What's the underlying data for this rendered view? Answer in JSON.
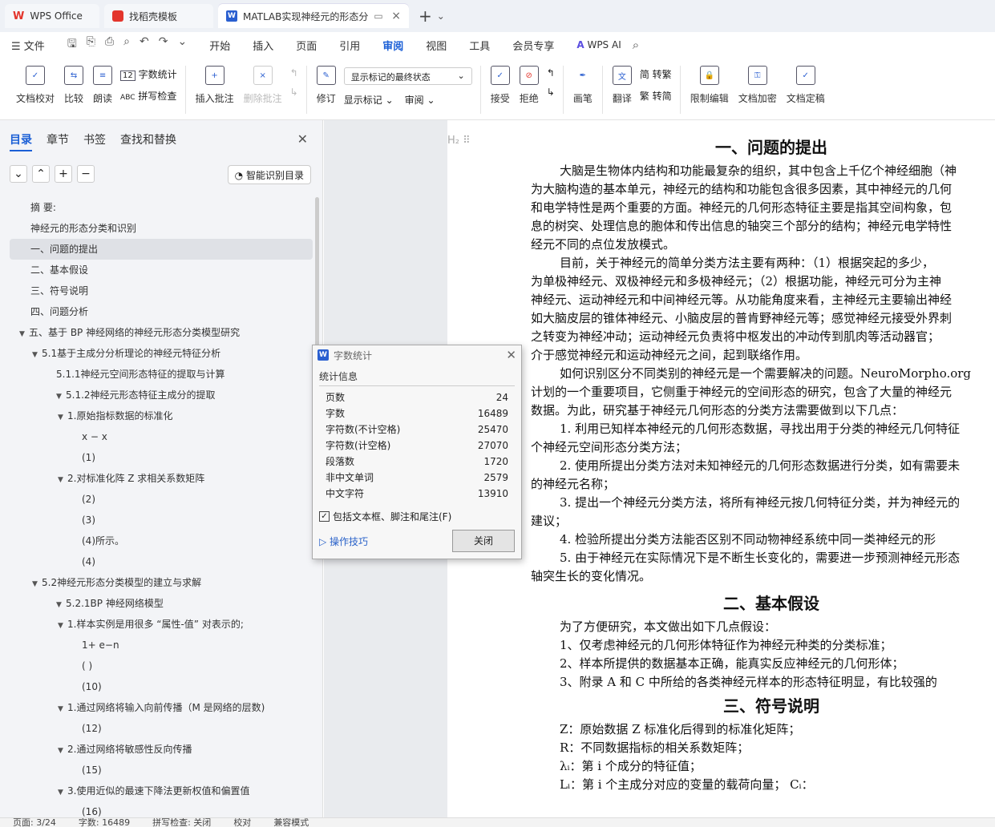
{
  "tabs": [
    {
      "label": "WPS Office",
      "icon": "wps-logo"
    },
    {
      "label": "找稻壳模板",
      "icon": "docer-logo"
    },
    {
      "label": "MATLAB实现神经元的形态分",
      "icon": "wps-writer-logo"
    }
  ],
  "menu": {
    "file": "文件",
    "items": [
      "开始",
      "插入",
      "页面",
      "引用",
      "审阅",
      "视图",
      "工具",
      "会员专享"
    ],
    "active": "审阅",
    "ai": "WPS AI"
  },
  "ribbon": {
    "doc_check": "文档校对",
    "compare": "比较",
    "read_aloud": "朗读",
    "word_count": "字数统计",
    "spell_check": "拼写检查",
    "insert_comment": "插入批注",
    "delete_comment": "删除批注",
    "revise": "修订",
    "markup_state": "显示标记的最终状态",
    "show_markup": "显示标记",
    "review": "审阅",
    "accept": "接受",
    "reject": "拒绝",
    "pen": "画笔",
    "translate": "翻译",
    "to_traditional": "简 转繁",
    "to_simplified": "繁 转简",
    "restrict_edit": "限制编辑",
    "encrypt": "文档加密",
    "finalize": "文档定稿"
  },
  "sidebar": {
    "tabs": [
      "目录",
      "章节",
      "书签",
      "查找和替换"
    ],
    "smart_btn": "智能识别目录",
    "toc": [
      {
        "label": "摘 要:",
        "level": 1,
        "arrow": ""
      },
      {
        "label": "神经元的形态分类和识别",
        "level": 1,
        "arrow": ""
      },
      {
        "label": "一、问题的提出",
        "level": 1,
        "arrow": "",
        "selected": true
      },
      {
        "label": "二、基本假设",
        "level": 1,
        "arrow": ""
      },
      {
        "label": "三、符号说明",
        "level": 1,
        "arrow": ""
      },
      {
        "label": "四、问题分析",
        "level": 1,
        "arrow": ""
      },
      {
        "label": "五、基于 BP 神经网络的神经元形态分类模型研究",
        "level": 0,
        "arrow": "▼"
      },
      {
        "label": "5.1基于主成分分析理论的神经元特征分析",
        "level": 2,
        "arrow": "▼"
      },
      {
        "label": "5.1.1神经元空间形态特征的提取与计算",
        "level": 3,
        "arrow": ""
      },
      {
        "label": "5.1.2神经元形态特征主成分的提取",
        "level": 3,
        "arrow": "▼"
      },
      {
        "label": "1.原始指标数据的标准化",
        "level": 4,
        "arrow": "▼"
      },
      {
        "label": "x − x",
        "level": 5,
        "arrow": ""
      },
      {
        "label": "(1)",
        "level": 5,
        "arrow": ""
      },
      {
        "label": "2.对标准化阵 Z 求相关系数矩阵",
        "level": 4,
        "arrow": "▼"
      },
      {
        "label": "(2)",
        "level": 5,
        "arrow": ""
      },
      {
        "label": "(3)",
        "level": 5,
        "arrow": ""
      },
      {
        "label": "(4)所示。",
        "level": 5,
        "arrow": ""
      },
      {
        "label": "(4)",
        "level": 5,
        "arrow": ""
      },
      {
        "label": "5.2神经元形态分类模型的建立与求解",
        "level": 2,
        "arrow": "▼"
      },
      {
        "label": "5.2.1BP 神经网络模型",
        "level": 3,
        "arrow": "▼"
      },
      {
        "label": "1.样本实例是用很多 “属性-值” 对表示的;",
        "level": 4,
        "arrow": "▼"
      },
      {
        "label": "1+ e−n",
        "level": 5,
        "arrow": ""
      },
      {
        "label": "( )",
        "level": 5,
        "arrow": ""
      },
      {
        "label": "(10)",
        "level": 5,
        "arrow": ""
      },
      {
        "label": "1.通过网络将输入向前传播（M 是网络的层数)",
        "level": 4,
        "arrow": "▼"
      },
      {
        "label": "(12)",
        "level": 5,
        "arrow": ""
      },
      {
        "label": "2.通过网络将敏感性反向传播",
        "level": 4,
        "arrow": "▼"
      },
      {
        "label": "(15)",
        "level": 5,
        "arrow": ""
      },
      {
        "label": "3.使用近似的最速下降法更新权值和偏置值",
        "level": 4,
        "arrow": "▼"
      },
      {
        "label": "(16)",
        "level": 5,
        "arrow": ""
      }
    ]
  },
  "document": {
    "heading_marker": "H₂",
    "section1_title": "一、问题的提出",
    "section1_paras": [
      {
        "text": "大脑是生物体内结构和功能最复杂的组织，其中包含上千亿个神经细胞（神",
        "indent": true
      },
      {
        "text": "为大脑构造的基本单元，神经元的结构和功能包含很多因素，其中神经元的几何",
        "indent": false
      },
      {
        "text": "和电学特性是两个重要的方面。神经元的几何形态特征主要是指其空间构象，包",
        "indent": false
      },
      {
        "text": "息的树突、处理信息的胞体和传出信息的轴突三个部分的结构；神经元电学特性",
        "indent": false
      },
      {
        "text": "经元不同的点位发放模式。",
        "indent": false
      },
      {
        "text": "目前，关于神经元的简单分类方法主要有两种：（1）根据突起的多少，",
        "indent": true
      },
      {
        "text": "为单极神经元、双极神经元和多极神经元；（2）根据功能，神经元可分为主神",
        "indent": false
      },
      {
        "text": "神经元、运动神经元和中间神经元等。从功能角度来看，主神经元主要输出神经",
        "indent": false
      },
      {
        "text": "如大脑皮层的锥体神经元、小脑皮层的普肯野神经元等；感觉神经元接受外界刺",
        "indent": false
      },
      {
        "text": "之转变为神经冲动；运动神经元负责将中枢发出的冲动传到肌肉等活动器官；",
        "indent": false
      },
      {
        "text": "介于感觉神经元和运动神经元之间，起到联络作用。",
        "indent": false
      },
      {
        "text": "如何识别区分不同类别的神经元是一个需要解决的问题。NeuroMorpho.org",
        "indent": true
      },
      {
        "text": "计划的一个重要项目，它侧重于神经元的空间形态的研究，包含了大量的神经元",
        "indent": false
      },
      {
        "text": "数据。为此，研究基于神经元几何形态的分类方法需要做到以下几点：",
        "indent": false
      },
      {
        "text": "1. 利用已知样本神经元的几何形态数据，寻找出用于分类的神经元几何特征",
        "indent": true
      },
      {
        "text": "个神经元空间形态分类方法；",
        "indent": false
      },
      {
        "text": "2. 使用所提出分类方法对未知神经元的几何形态数据进行分类，如有需要未",
        "indent": true
      },
      {
        "text": "的神经元名称；",
        "indent": false
      },
      {
        "text": "3. 提出一个神经元分类方法，将所有神经元按几何特征分类，并为神经元的",
        "indent": true
      },
      {
        "text": "建议；",
        "indent": false
      },
      {
        "text": "4. 检验所提出分类方法能否区别不同动物神经系统中同一类神经元的形",
        "indent": true
      },
      {
        "text": "5. 由于神经元在实际情况下是不断生长变化的，需要进一步预测神经元形态",
        "indent": true
      },
      {
        "text": "轴突生长的变化情况。",
        "indent": false
      }
    ],
    "section2_title": "二、基本假设",
    "section2_paras": [
      {
        "text": "为了方便研究，本文做出如下几点假设：",
        "indent": true
      },
      {
        "text": "1、仅考虑神经元的几何形体特征作为神经元种类的分类标准；",
        "indent": true
      },
      {
        "text": "2、样本所提供的数据基本正确，能真实反应神经元的几何形体；",
        "indent": true
      },
      {
        "text": "3、附录 A 和 C 中所给的各类神经元样本的形态特征明显，有比较强的",
        "indent": true
      }
    ],
    "section3_title": "三、符号说明",
    "section3_paras": [
      {
        "text": "Z：原始数据 Z 标准化后得到的标准化矩阵；",
        "indent": true
      },
      {
        "text": "R：不同数据指标的相关系数矩阵；",
        "indent": true
      },
      {
        "text": "λᵢ：第 i 个成分的特征值；",
        "indent": true
      },
      {
        "text": "Lᵢ：第 i 个主成分对应的变量的载荷向量；  Cᵢ：",
        "indent": true
      }
    ]
  },
  "dialog": {
    "title": "字数统计",
    "group": "统计信息",
    "rows": [
      {
        "label": "页数",
        "value": "24"
      },
      {
        "label": "字数",
        "value": "16489"
      },
      {
        "label": "字符数(不计空格)",
        "value": "25470"
      },
      {
        "label": "字符数(计空格)",
        "value": "27070"
      },
      {
        "label": "段落数",
        "value": "1720"
      },
      {
        "label": "非中文单词",
        "value": "2579"
      },
      {
        "label": "中文字符",
        "value": "13910"
      }
    ],
    "checkbox_label": "包括文本框、脚注和尾注(F)",
    "checked": true,
    "tips": "操作技巧",
    "close": "关闭"
  },
  "status": {
    "page": "页面: 3/24",
    "words": "字数: 16489",
    "spell": "拼写检查: 关闭",
    "proof": "校对",
    "compat": "兼容模式"
  },
  "colors": {
    "accent": "#1b5fd6",
    "wps_red": "#e3352c"
  }
}
